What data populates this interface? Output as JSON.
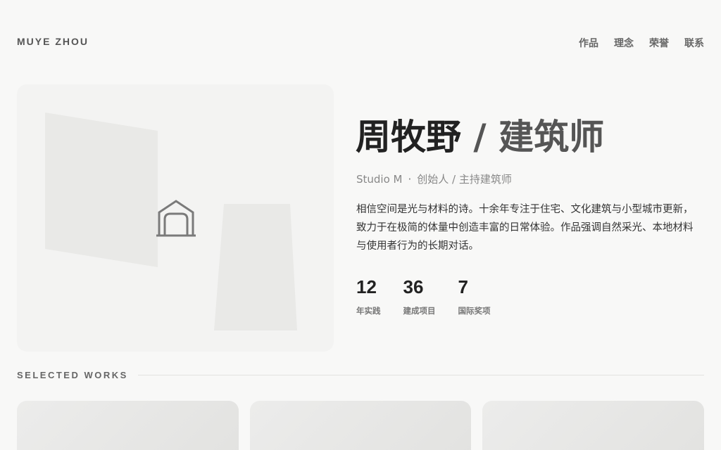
{
  "header": {
    "brand": "MUYE ZHOU",
    "nav": [
      "作品",
      "理念",
      "荣誉",
      "联系"
    ]
  },
  "hero": {
    "image_icon": "house-icon",
    "name": "周牧野",
    "separator": " / ",
    "profession": "建筑师",
    "studio": "Studio M",
    "dot": "·",
    "role": "创始人 / 主持建筑师",
    "bio": "相信空间是光与材料的诗。十余年专注于住宅、文化建筑与小型城市更新，致力于在极简的体量中创造丰富的日常体验。作品强调自然采光、本地材料与使用者行为的长期对话。"
  },
  "stats": [
    {
      "value": "12",
      "label": "年实践"
    },
    {
      "value": "36",
      "label": "建成项目"
    },
    {
      "value": "7",
      "label": "国际奖项"
    }
  ],
  "works": {
    "title": "SELECTED WORKS",
    "card_count_visible": 3
  },
  "colors": {
    "background": "#f8f8f7",
    "text": "#222222",
    "muted": "#888888"
  }
}
